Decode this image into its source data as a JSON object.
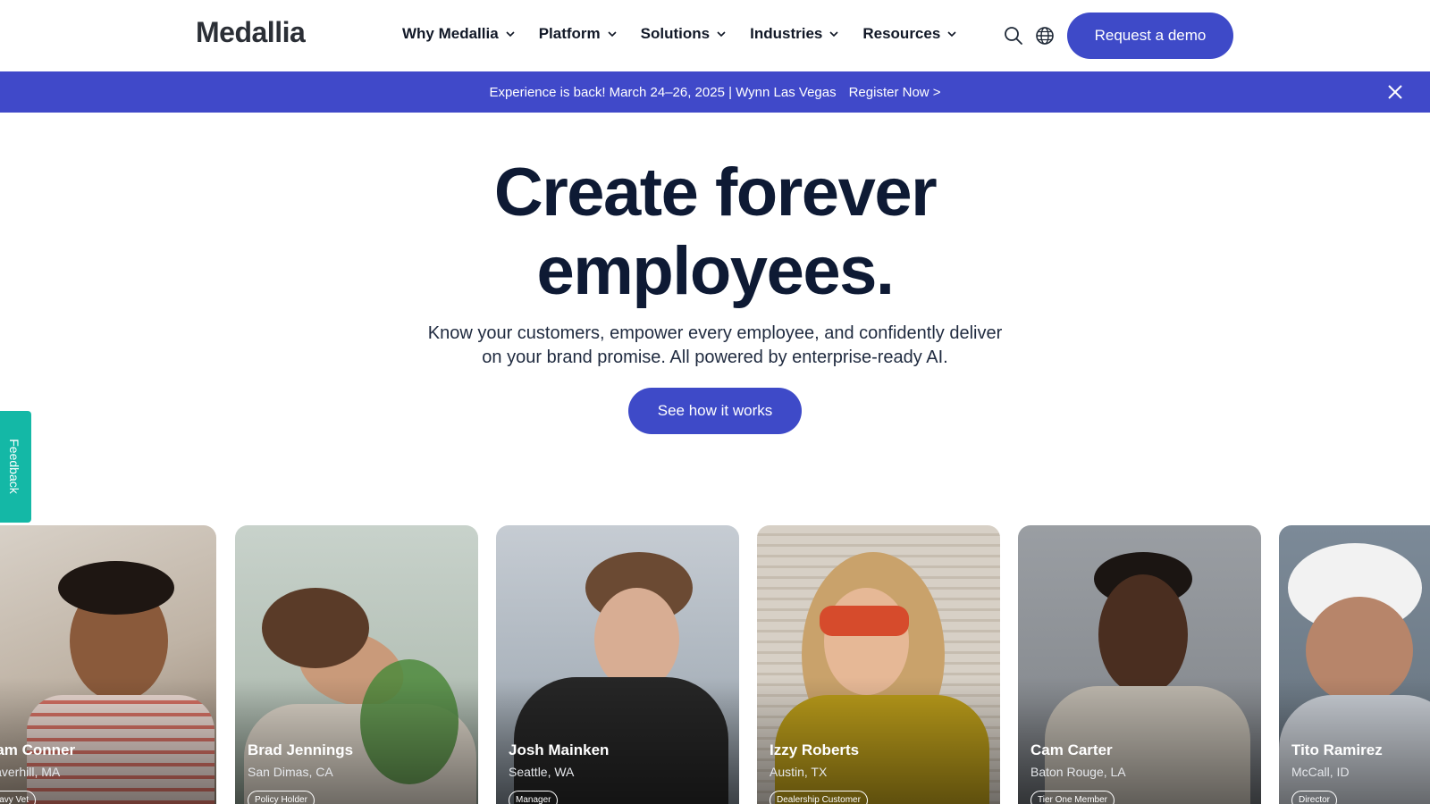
{
  "header": {
    "logo": "Medallia",
    "nav": [
      {
        "label": "Why Medallia"
      },
      {
        "label": "Platform"
      },
      {
        "label": "Solutions"
      },
      {
        "label": "Industries"
      },
      {
        "label": "Resources"
      }
    ],
    "icons": [
      "search-icon",
      "globe-icon"
    ],
    "cta": "Request a demo"
  },
  "banner": {
    "text": "Experience is back! March 24–26, 2025 | Wynn Las Vegas",
    "link": "Register Now >",
    "close_icon": "close-icon"
  },
  "hero": {
    "title_line1": "Create forever",
    "title_line2": "employees.",
    "subtitle_line1": "Know your customers, empower every employee, and confidently deliver",
    "subtitle_line2": "on your brand promise. All powered by enterprise-ready AI.",
    "cta": "See how it works"
  },
  "feedback": {
    "label": "Feedback"
  },
  "cards": [
    {
      "name": "Sam Conner",
      "location": "Haverhill, MA",
      "tag": "Navy Vet"
    },
    {
      "name": "Brad Jennings",
      "location": "San Dimas, CA",
      "tag": "Policy Holder"
    },
    {
      "name": "Josh Mainken",
      "location": "Seattle, WA",
      "tag": "Manager"
    },
    {
      "name": "Izzy Roberts",
      "location": "Austin, TX",
      "tag": "Dealership Customer"
    },
    {
      "name": "Cam Carter",
      "location": "Baton Rouge, LA",
      "tag": "Tier One Member"
    },
    {
      "name": "Tito Ramirez",
      "location": "McCall, ID",
      "tag": "Director"
    }
  ],
  "colors": {
    "brand": "#3e4ac8",
    "banner": "#4049c9",
    "heading": "#0e1a34",
    "feedback": "#14b8a6"
  }
}
